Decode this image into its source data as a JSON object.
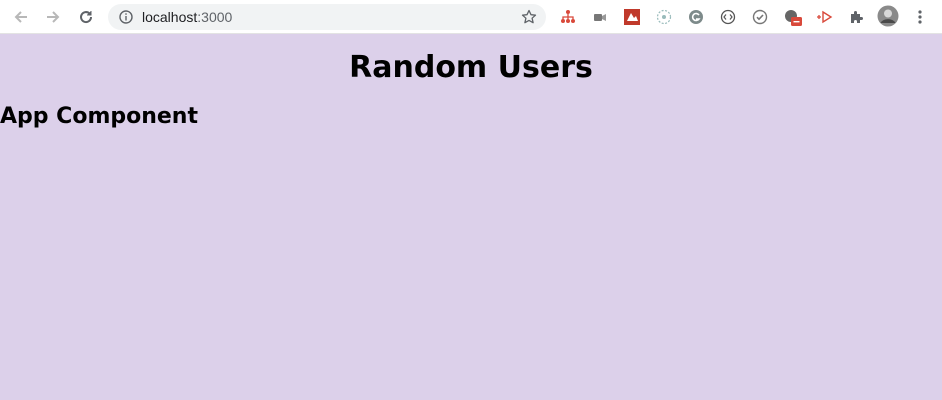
{
  "browser": {
    "url_host": "localhost",
    "url_port": ":3000",
    "icons": {
      "back": "back-arrow-icon",
      "forward": "forward-arrow-icon",
      "reload": "reload-icon",
      "info": "site-info-icon",
      "bookmark": "bookmark-star-icon",
      "extensions": "puzzle-icon",
      "menu": "kebab-menu-icon"
    }
  },
  "page": {
    "title": "Random Users",
    "component_heading": "App Component"
  },
  "colors": {
    "page_background": "#dcd0ea",
    "toolbar_background": "#ffffff",
    "omnibox_background": "#f1f3f4"
  }
}
